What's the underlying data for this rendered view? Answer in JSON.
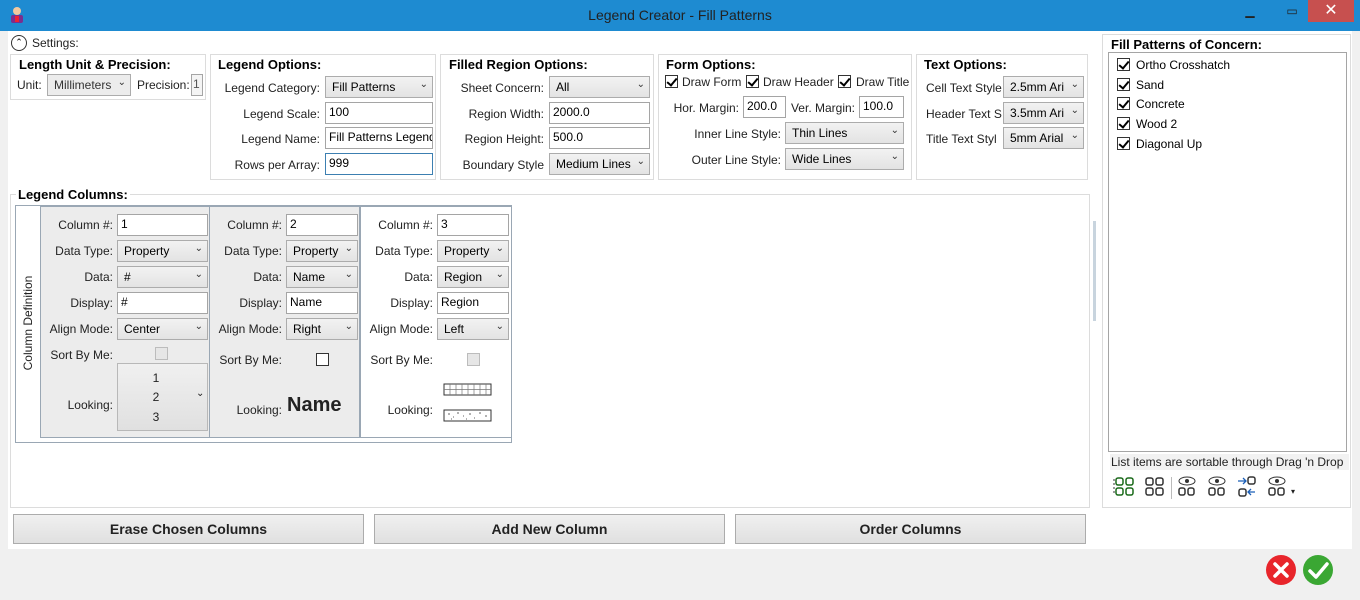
{
  "window": {
    "title": "Legend Creator - Fill Patterns"
  },
  "settings": {
    "label": "Settings:"
  },
  "length_unit": {
    "title": "Length Unit & Precision:",
    "unit_label": "Unit:",
    "unit_value": "Millimeters",
    "precision_label": "Precision:",
    "precision_value": "1"
  },
  "legend_options": {
    "title": "Legend Options:",
    "category_label": "Legend Category:",
    "category_value": "Fill Patterns",
    "scale_label": "Legend Scale:",
    "scale_value": "100",
    "name_label": "Legend Name:",
    "name_value": "Fill Patterns Legend",
    "rows_label": "Rows per Array:",
    "rows_value": "999"
  },
  "filled_region": {
    "title": "Filled Region Options:",
    "sheet_label": "Sheet Concern:",
    "sheet_value": "All",
    "width_label": "Region Width:",
    "width_value": "2000.0",
    "height_label": "Region Height:",
    "height_value": "500.0",
    "boundary_label": "Boundary Style",
    "boundary_value": "Medium Lines"
  },
  "form_options": {
    "title": "Form Options:",
    "draw_form": "Draw Form",
    "draw_header": "Draw Header",
    "draw_title": "Draw Title",
    "hor_label": "Hor. Margin:",
    "hor_value": "200.0",
    "ver_label": "Ver. Margin:",
    "ver_value": "100.0",
    "inner_label": "Inner Line Style:",
    "inner_value": "Thin Lines",
    "outer_label": "Outer Line Style:",
    "outer_value": "Wide Lines"
  },
  "text_options": {
    "title": "Text Options:",
    "cell_label": "Cell Text Style",
    "cell_value": "2.5mm Ari",
    "header_label": "Header Text S",
    "header_value": "3.5mm Ari",
    "title_label": "Title Text Styl",
    "title_value": "5mm Arial"
  },
  "columns": {
    "title": "Legend Columns:",
    "side_label": "Column Definition",
    "labels": {
      "number": "Column #:",
      "data_type": "Data Type:",
      "data": "Data:",
      "display": "Display:",
      "align": "Align Mode:",
      "sort": "Sort By Me:",
      "looking": "Looking:"
    },
    "items": [
      {
        "number": "1",
        "data_type": "Property",
        "data": "#",
        "display": "#",
        "align": "Center",
        "looking": [
          "1",
          "2",
          "3"
        ]
      },
      {
        "number": "2",
        "data_type": "Property",
        "data": "Name",
        "display": "Name",
        "align": "Right",
        "looking_text": "Name"
      },
      {
        "number": "3",
        "data_type": "Property",
        "data": "Region",
        "display": "Region",
        "align": "Left"
      }
    ]
  },
  "buttons": {
    "erase": "Erase Chosen Columns",
    "add": "Add New Column",
    "order": "Order Columns"
  },
  "fill_patterns": {
    "title": "Fill Patterns of Concern:",
    "items": [
      "Ortho Crosshatch",
      "Sand",
      "Concrete",
      "Wood 2",
      "Diagonal Up"
    ],
    "hint": "List items are sortable through Drag 'n Drop"
  },
  "colors": {
    "titlebar": "#1e8bd1",
    "close": "#c7504f",
    "cancel": "#e8252b",
    "ok": "#3aa733"
  }
}
